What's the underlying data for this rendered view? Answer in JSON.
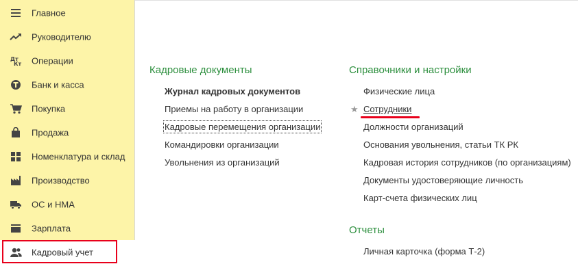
{
  "sidebar": {
    "items": [
      {
        "label": "Главное",
        "icon": "menu-lines-icon"
      },
      {
        "label": "Руководителю",
        "icon": "trend-icon"
      },
      {
        "label": "Операции",
        "icon": "dt-kt-icon"
      },
      {
        "label": "Банк и касса",
        "icon": "bank-icon"
      },
      {
        "label": "Покупка",
        "icon": "cart-icon"
      },
      {
        "label": "Продажа",
        "icon": "shopping-bag-icon"
      },
      {
        "label": "Номенклатура и склад",
        "icon": "warehouse-icon"
      },
      {
        "label": "Производство",
        "icon": "factory-icon"
      },
      {
        "label": "ОС и НМА",
        "icon": "truck-icon"
      },
      {
        "label": "Зарплата",
        "icon": "salary-icon"
      },
      {
        "label": "Кадровый учет",
        "icon": "users-icon"
      }
    ],
    "active_item": "Кадровый учет"
  },
  "hr_documents": {
    "title": "Кадровые документы",
    "links": [
      "Журнал кадровых документов",
      "Приемы на работу в организации",
      "Кадровые перемещения организации",
      "Командировки организации",
      "Увольнения из организаций"
    ]
  },
  "directories": {
    "title": "Справочники и настройки",
    "links": [
      "Физические лица",
      "Сотрудники",
      "Должности организаций",
      "Основания увольнения, статьи ТК РК",
      "Кадровая история сотрудников (по организациям)",
      "Документы удостоверяющие личность",
      "Карт-счета физических лиц"
    ],
    "favorite_mark": "★"
  },
  "reports": {
    "title": "Отчеты",
    "links": [
      "Личная карточка (форма Т-2)"
    ]
  },
  "colors": {
    "sidebar_bg": "#fdf4a8",
    "section_title": "#2d8f3e",
    "highlight_red": "#e8001b"
  }
}
